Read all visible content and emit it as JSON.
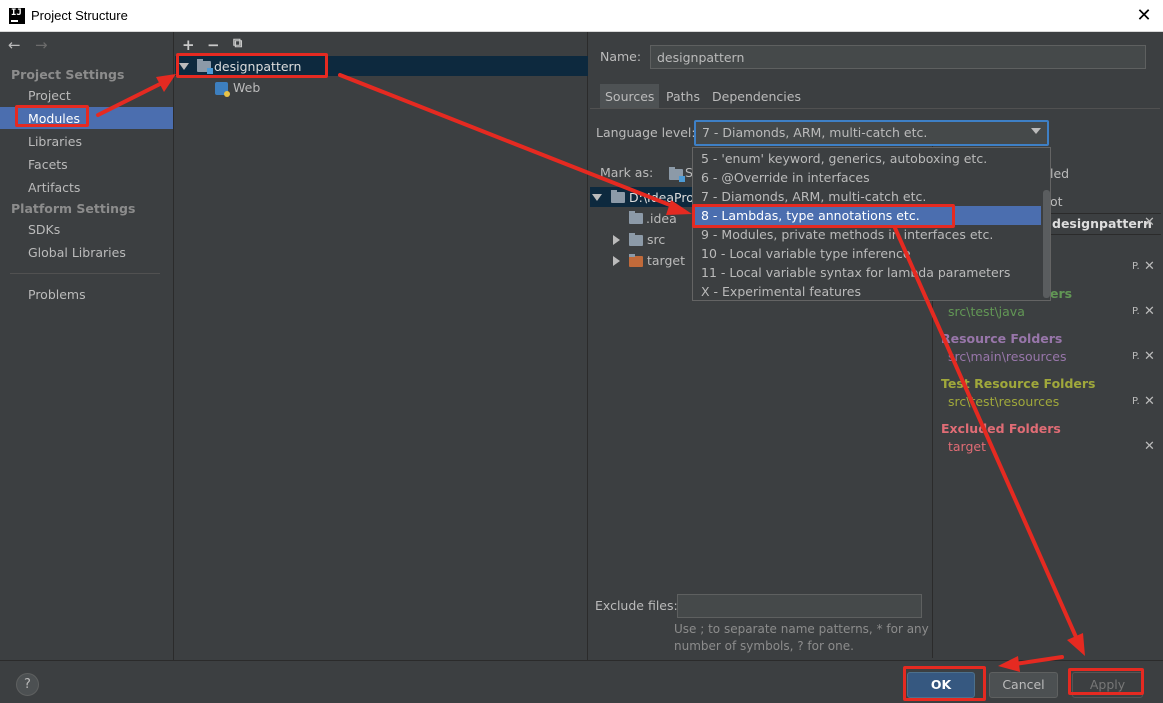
{
  "window": {
    "title": "Project Structure",
    "close_glyph": "✕"
  },
  "left_nav": {
    "back_glyph": "←",
    "forward_glyph": "→",
    "project_settings_header": "Project Settings",
    "project_settings": [
      "Project",
      "Modules",
      "Libraries",
      "Facets",
      "Artifacts"
    ],
    "platform_settings_header": "Platform Settings",
    "platform_settings": [
      "SDKs",
      "Global Libraries"
    ],
    "problems": "Problems",
    "selected": "Modules"
  },
  "module_tree": {
    "add_glyph": "+",
    "remove_glyph": "−",
    "copy_glyph": "⧉",
    "module_name": "designpattern",
    "child": "Web"
  },
  "module_settings": {
    "name_label": "Name:",
    "name_value": "designpattern",
    "tabs": [
      "Sources",
      "Paths",
      "Dependencies"
    ],
    "active_tab": "Sources",
    "language_level_label": "Language level:",
    "language_level_value": "7 - Diamonds, ARM, multi-catch etc.",
    "language_options": [
      "5 - 'enum' keyword, generics, autoboxing etc.",
      "6 - @Override in interfaces",
      "7 - Diamonds, ARM, multi-catch etc.",
      "8 - Lambdas, type annotations etc.",
      "9 - Modules, private methods in interfaces etc.",
      "10 - Local variable type inference",
      "11 - Local variable syntax for lambda parameters",
      "X - Experimental features"
    ],
    "highlighted_option": "8 - Lambdas, type annotations etc.",
    "mark_as_label": "Mark as:",
    "mark_as_partial": "S",
    "content_tree": {
      "root": "D:\\IdeaPro",
      "children": [
        ".idea",
        "src",
        "target"
      ]
    },
    "right_partial": {
      "excluded_partial": "led",
      "root_partial": "ot"
    },
    "content_root_header": "designpattern",
    "categories": {
      "test_source_title_partial": "ers",
      "test_source_path": "src\\test\\java",
      "resource_title": "Resource Folders",
      "resource_path": "src\\main\\resources",
      "test_resource_title": "Test Resource Folders",
      "test_resource_path": "src\\test\\resources",
      "excluded_title": "Excluded Folders",
      "excluded_path": "target"
    },
    "exclude_files_label": "Exclude files:",
    "exclude_files_value": "",
    "hint": "Use ; to separate name patterns, * for any number of symbols, ? for one."
  },
  "buttons": {
    "help": "?",
    "ok": "OK",
    "cancel": "Cancel",
    "apply": "Apply"
  },
  "colors": {
    "background": "#3c3f41",
    "selection": "#4b6eaf",
    "annotation_red": "#e52a21",
    "test_source_green": "#629755",
    "resource_purple": "#9876aa",
    "test_resource_olive": "#a0a83b",
    "excluded_red": "#e06c75"
  }
}
